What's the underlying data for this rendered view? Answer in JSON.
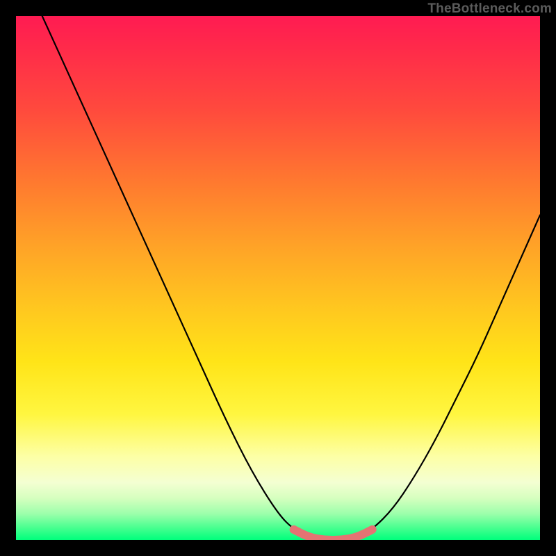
{
  "watermark": "TheBottleneck.com",
  "colors": {
    "frame": "#000000",
    "curve": "#000000",
    "highlight": "#e57373",
    "gradient_top": "#ff1b52",
    "gradient_bottom": "#00ff7c"
  },
  "chart_data": {
    "type": "line",
    "title": "",
    "xlabel": "",
    "ylabel": "",
    "xlim": [
      0,
      100
    ],
    "ylim": [
      0,
      100
    ],
    "series": [
      {
        "name": "bottleneck-curve",
        "x": [
          5,
          10,
          15,
          20,
          25,
          30,
          35,
          40,
          45,
          50,
          53,
          56,
          59,
          62,
          65,
          68,
          72,
          76,
          80,
          84,
          88,
          92,
          96,
          100
        ],
        "y": [
          100,
          89,
          78,
          67,
          56,
          45,
          34,
          23,
          13,
          5,
          2,
          0.5,
          0,
          0,
          0.5,
          2,
          6,
          12,
          19,
          27,
          35,
          44,
          53,
          62
        ]
      }
    ],
    "annotations": [
      {
        "name": "valley-highlight",
        "x_range": [
          53,
          68
        ],
        "note": "pink thick segment at curve minimum"
      }
    ]
  }
}
